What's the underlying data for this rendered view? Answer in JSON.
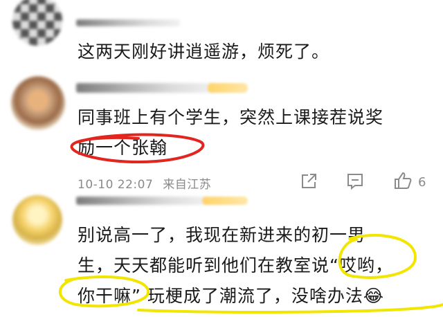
{
  "comments": [
    {
      "text_lines": [
        "这两天刚好讲逍遥游，烦死了。"
      ]
    },
    {
      "text_lines": [
        "同事班上有个学生，突然上课接茬说奖",
        "励一个张翰"
      ],
      "meta": {
        "time": "10-10 22:07",
        "source": "来自江苏"
      },
      "actions": {
        "like_count": "6"
      }
    },
    {
      "text_lines": [
        "别说高一了，我现在新进来的初一男",
        "生，天天都能听到他们在教室说“哎哟，",
        "你干嘛”  玩梗成了潮流了，没啥办法😂"
      ]
    }
  ],
  "colors": {
    "text": "#1a1a1a",
    "meta": "#8a8a8a",
    "red_annotation": "#e0261f",
    "yellow_annotation": "#f2e600"
  },
  "icons": [
    "share-icon",
    "comment-icon",
    "like-icon"
  ]
}
